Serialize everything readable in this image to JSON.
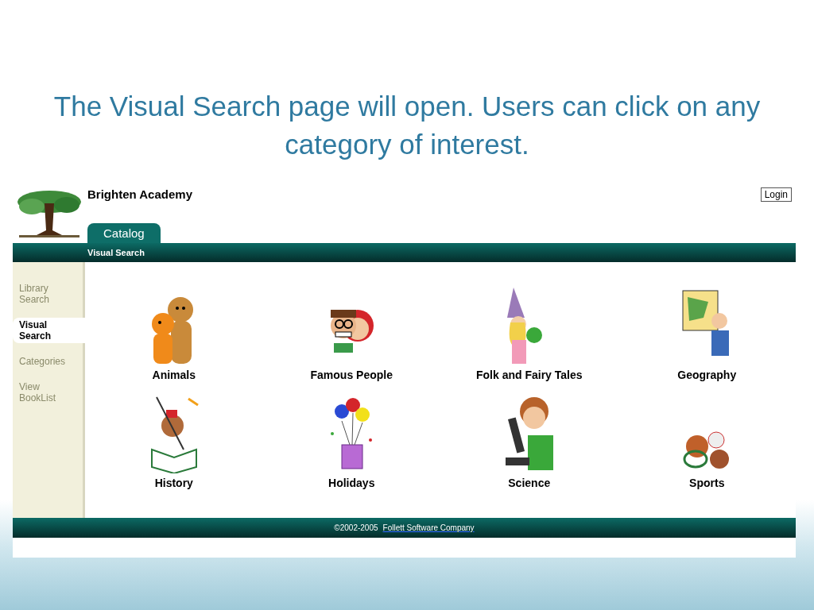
{
  "slide_title": "The Visual Search page will open.  Users can click on any category of interest.",
  "site": {
    "name": "Brighten Academy",
    "login": "Login"
  },
  "tabs": [
    {
      "label": "Catalog",
      "selected": true
    }
  ],
  "breadcrumb": "Visual Search",
  "sidebar": {
    "items": [
      {
        "label": "Library Search",
        "selected": false
      },
      {
        "label": "Visual Search",
        "selected": true
      },
      {
        "label": "Categories",
        "selected": false
      },
      {
        "label": "View BookList",
        "selected": false
      }
    ]
  },
  "categories": [
    {
      "label": "Animals",
      "kind": "animals"
    },
    {
      "label": "Famous People",
      "kind": "people"
    },
    {
      "label": "Folk and Fairy Tales",
      "kind": "fairy"
    },
    {
      "label": "Geography",
      "kind": "geography"
    },
    {
      "label": "History",
      "kind": "history"
    },
    {
      "label": "Holidays",
      "kind": "holidays"
    },
    {
      "label": "Science",
      "kind": "science"
    },
    {
      "label": "Sports",
      "kind": "sports"
    }
  ],
  "footer": {
    "copyright": "©2002-2005",
    "company": "Follett Software Company"
  }
}
